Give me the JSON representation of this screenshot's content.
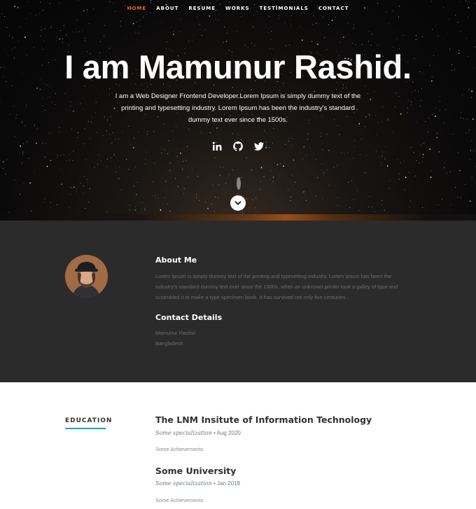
{
  "nav": {
    "items": [
      {
        "label": "HOME",
        "active": true
      },
      {
        "label": "ABOUT",
        "active": false
      },
      {
        "label": "RESUME",
        "active": false
      },
      {
        "label": "WORKS",
        "active": false
      },
      {
        "label": "TESTIMONIALS",
        "active": false
      },
      {
        "label": "CONTACT",
        "active": false
      }
    ]
  },
  "hero": {
    "title": "I am Mamunur Rashid.",
    "description": "I am a Web Designer Frontend Developer.Lorem Ipsum is simply dummy text of the printing and typesetting industry. Lorem Ipsum has been the industry's standard dummy text ever since the 1500s.",
    "social_icons": [
      "linkedin-icon",
      "github-icon",
      "twitter-icon"
    ]
  },
  "about": {
    "heading": "About Me",
    "text": "Lorem Ipsum is simply dummy text of the printing and typesetting industry. Lorem Ipsum has been the industry's standard dummy text ever since the 1500s, when an unknown printer took a galley of type and scrambled it to make a type specimen book. It has survived not only five centuries.",
    "contact_heading": "Contact Details",
    "contact_name": "Mamunur Rashid",
    "contact_location": "Bangladesh"
  },
  "education": {
    "label": "EDUCATION",
    "entries": [
      {
        "school": "The LNM Insitute of Information Technology",
        "specialization": "Some specialization",
        "date": "Aug 2020",
        "achievements": "Some Achievements"
      },
      {
        "school": "Some University",
        "specialization": "Some specialization",
        "date": "Jan 2018",
        "achievements": "Some Achievements"
      }
    ]
  },
  "colors": {
    "accent": "#e8672a",
    "teal": "#11abb0",
    "about_bg": "#2b2b2b"
  }
}
